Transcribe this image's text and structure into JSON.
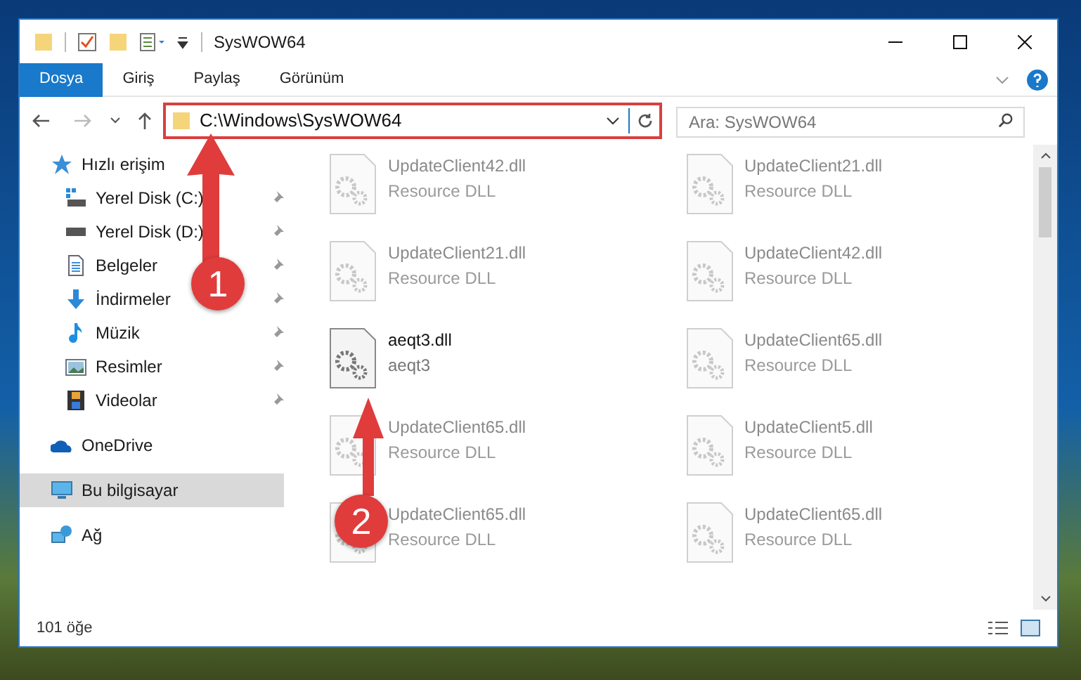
{
  "window": {
    "title": "SysWOW64"
  },
  "ribbon_tabs": [
    {
      "label": "Dosya",
      "selected": true
    },
    {
      "label": "Giriş",
      "selected": false
    },
    {
      "label": "Paylaş",
      "selected": false
    },
    {
      "label": "Görünüm",
      "selected": false
    }
  ],
  "address_bar": {
    "path": "C:\\Windows\\SysWOW64"
  },
  "search": {
    "placeholder": "Ara: SysWOW64"
  },
  "sidebar": {
    "items": [
      {
        "label": "Hızlı erişim",
        "selected": false,
        "children": [
          {
            "label": "Yerel Disk (C:)",
            "pinned": true,
            "selected": false
          },
          {
            "label": "Yerel Disk (D:)",
            "pinned": true,
            "selected": false
          },
          {
            "label": "Belgeler",
            "pinned": true,
            "selected": false
          },
          {
            "label": "İndirmeler",
            "pinned": true,
            "selected": false
          },
          {
            "label": "Müzik",
            "pinned": true,
            "selected": false
          },
          {
            "label": "Resimler",
            "pinned": true,
            "selected": false
          },
          {
            "label": "Videolar",
            "pinned": true,
            "selected": false
          }
        ]
      },
      {
        "label": "OneDrive",
        "selected": false
      },
      {
        "label": "Bu bilgisayar",
        "selected": true
      },
      {
        "label": "Ağ",
        "selected": false
      }
    ]
  },
  "files": [
    {
      "name": "UpdateClient42.dll",
      "type": "Resource DLL",
      "faded": true
    },
    {
      "name": "UpdateClient21.dll",
      "type": "Resource DLL",
      "faded": true
    },
    {
      "name": "UpdateClient21.dll",
      "type": "Resource DLL",
      "faded": true
    },
    {
      "name": "UpdateClient42.dll",
      "type": "Resource DLL",
      "faded": true
    },
    {
      "name": "aeqt3.dll",
      "type": "aeqt3",
      "faded": false
    },
    {
      "name": "UpdateClient65.dll",
      "type": "Resource DLL",
      "faded": true
    },
    {
      "name": "UpdateClient65.dll",
      "type": "Resource DLL",
      "faded": true
    },
    {
      "name": "UpdateClient5.dll",
      "type": "Resource DLL",
      "faded": true
    },
    {
      "name": "UpdateClient65.dll",
      "type": "Resource DLL",
      "faded": true
    },
    {
      "name": "UpdateClient65.dll",
      "type": "Resource DLL",
      "faded": true
    }
  ],
  "status_bar": {
    "item_count": "101 öğe"
  },
  "annotations": [
    {
      "number": "1"
    },
    {
      "number": "2"
    }
  ]
}
